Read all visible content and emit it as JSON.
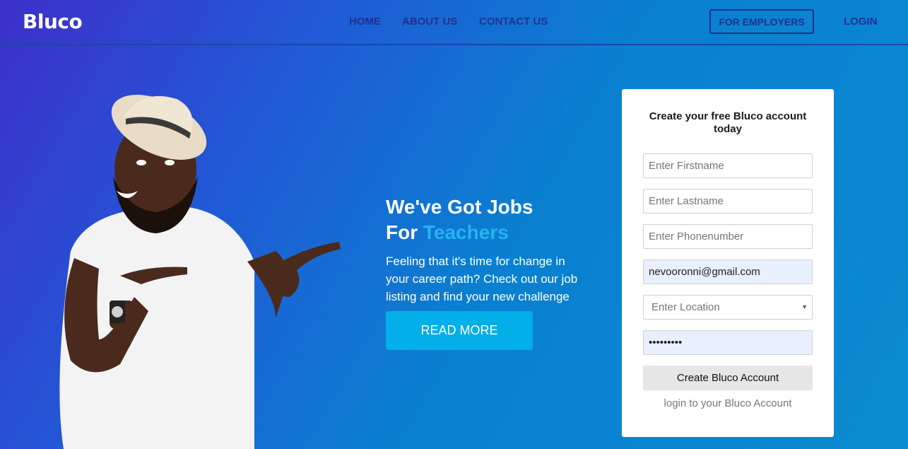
{
  "header": {
    "logo": "Bluco",
    "nav": {
      "home": "HOME",
      "about": "ABOUT US",
      "contact": "CONTACT US"
    },
    "employers_button": "FOR EMPLOYERS",
    "login": "LOGIN"
  },
  "hero": {
    "title_line1": "We've Got Jobs",
    "title_for": "For",
    "title_accent": "Teachers",
    "description": "Feeling that it's time for change in your career path? Check out our job listing and find your new challenge",
    "read_more": "READ MORE"
  },
  "signup": {
    "title": "Create your free Bluco account today",
    "firstname_placeholder": "Enter Firstname",
    "lastname_placeholder": "Enter Lastname",
    "phone_placeholder": "Enter Phonenumber",
    "email_value": "nevooronni@gmail.com",
    "location_selected": "Enter Location",
    "password_value": "password1",
    "submit": "Create Bluco Account",
    "login_link": "login to your Bluco Account"
  },
  "colors": {
    "accent": "#27b4ee",
    "button": "#02afe8",
    "nav_text": "#23308f"
  },
  "icons": {
    "select_arrow": "chevron-down-icon"
  }
}
